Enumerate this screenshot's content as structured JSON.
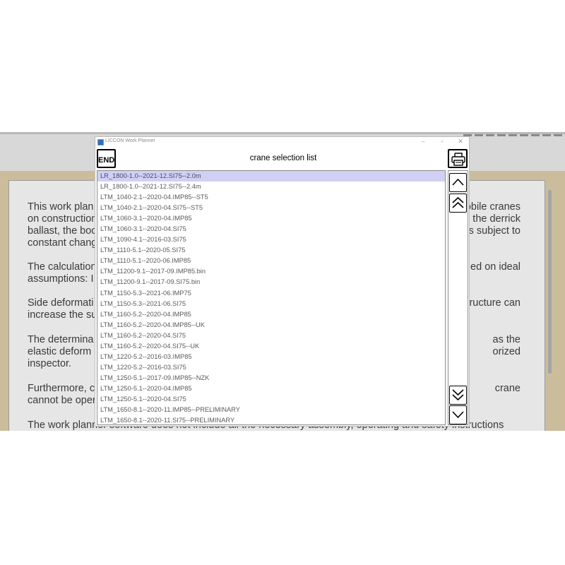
{
  "background": {
    "paragraphs": [
      {
        "left": "This work plan",
        "right": "obile cranes"
      },
      {
        "left": "on construction",
        "right": "the derrick"
      },
      {
        "left": "ballast, the boo",
        "right": "s subject to"
      },
      {
        "left": "constant chang",
        "right": ""
      },
      {
        "left": "The calculation",
        "right": "ed on ideal"
      },
      {
        "left": "assumptions: I",
        "right": ""
      },
      {
        "left": "Side deformati",
        "right": "ructure can"
      },
      {
        "left": "increase the su",
        "right": ""
      },
      {
        "left": "The determina",
        "right": "as the"
      },
      {
        "left": "elastic deform",
        "right": "orized"
      },
      {
        "left": "inspector.",
        "right": ""
      },
      {
        "left": "Furthermore, c",
        "right": "crane"
      },
      {
        "left": "cannot be oper",
        "right": ""
      },
      {
        "left": "The work planner software does not include all the necessary assembly, operating and safety instructions",
        "right": ""
      }
    ]
  },
  "dialog": {
    "window_title": "LICCON Work Planner",
    "end_label": "END",
    "heading": "crane selection list",
    "selected_index": 0,
    "items": [
      "LR_1800-1.0--2021-12.SI75--2.0m",
      "LR_1800-1.0--2021-12.SI75--2.4m",
      "LTM_1040-2.1--2020-04.IMP85--ST5",
      "LTM_1040-2.1--2020-04.SI75--ST5",
      "LTM_1060-3.1--2020-04.IMP85",
      "LTM_1060-3.1--2020-04.SI75",
      "LTM_1090-4.1--2016-03.SI75",
      "LTM_1110-5.1--2020-05.SI75",
      "LTM_1110-5.1--2020-06.IMP85",
      "LTM_11200-9.1--2017-09.IMP85.bin",
      "LTM_11200-9.1--2017-09.SI75.bin",
      "LTM_1150-5.3--2021-06.IMP75",
      "LTM_1150-5.3--2021-06.SI75",
      "LTM_1160-5.2--2020-04.IMP85",
      "LTM_1160-5.2--2020-04.IMP85--UK",
      "LTM_1160-5.2--2020-04.SI75",
      "LTM_1160-5.2--2020-04.SI75--UK",
      "LTM_1220-5.2--2016-03.IMP85",
      "LTM_1220-5.2--2016-03.SI75",
      "LTM_1250-5.1--2017-09.IMP85--NZK",
      "LTM_1250-5.1--2020-04.IMP85",
      "LTM_1250-5.1--2020-04.SI75",
      "LTM_1650-8.1--2020-11.IMP85--PRELIMINARY",
      "LTM_1650-8.1--2020-11.SI75--PRELIMINARY"
    ]
  },
  "icons": {
    "end": "end-button",
    "print": "printer-icon",
    "up": "chevron-up-icon",
    "page_up": "double-chevron-up-icon",
    "page_down": "double-chevron-down-icon",
    "down": "chevron-down-icon",
    "minimize": "minimize-icon",
    "restore": "restore-icon",
    "close": "close-icon"
  },
  "colors": {
    "selection": "#cfd0f3",
    "background_panel": "#cbbd9c",
    "document": "#e6e6e6"
  }
}
